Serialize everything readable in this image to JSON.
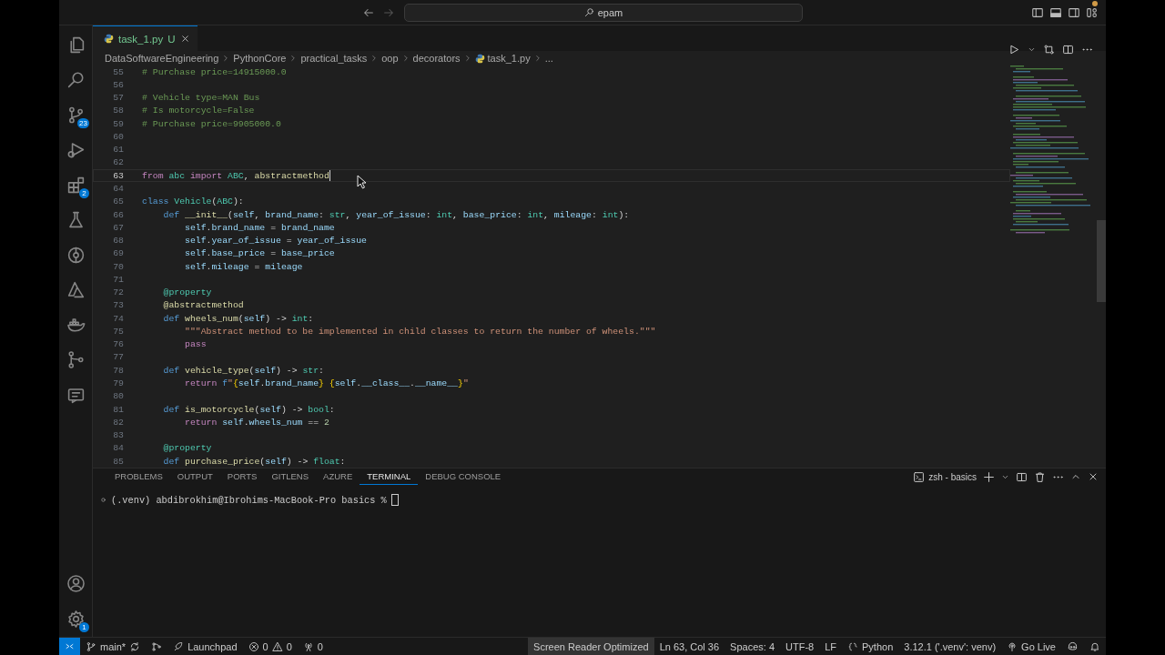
{
  "title_bar": {
    "search": "epam"
  },
  "activity_bar": {
    "top": [
      {
        "kind": "files"
      },
      {
        "kind": "search"
      },
      {
        "kind": "source-control",
        "badge": "23"
      },
      {
        "kind": "run-debug"
      },
      {
        "kind": "extensions",
        "badge": "2"
      },
      {
        "kind": "testing"
      },
      {
        "kind": "gitlens"
      },
      {
        "kind": "azure"
      },
      {
        "kind": "docker"
      },
      {
        "kind": "git-graph"
      },
      {
        "kind": "remote"
      }
    ],
    "bottom": [
      {
        "kind": "account"
      },
      {
        "kind": "settings",
        "badge": "1"
      }
    ]
  },
  "tabs": [
    {
      "label": "task_1.py",
      "status": "U",
      "selected": true
    }
  ],
  "breadcrumb": [
    {
      "text": "DataSoftwareEngineering",
      "kind": "folder"
    },
    {
      "text": "PythonCore",
      "kind": "folder"
    },
    {
      "text": "practical_tasks",
      "kind": "folder"
    },
    {
      "text": "oop",
      "kind": "folder"
    },
    {
      "text": "decorators",
      "kind": "folder"
    },
    {
      "text": "task_1.py",
      "kind": "file"
    },
    {
      "text": "...",
      "kind": "more"
    }
  ],
  "editor": {
    "lines": [
      {
        "number": "55",
        "active": false,
        "tokens": [
          {
            "text": "# Purchase price=14915000.0",
            "kind": "comment"
          }
        ]
      },
      {
        "number": "56",
        "active": false
      },
      {
        "number": "57",
        "active": false,
        "tokens": [
          {
            "text": "# Vehicle type=MAN Bus",
            "kind": "comment"
          }
        ]
      },
      {
        "number": "58",
        "active": false,
        "tokens": [
          {
            "text": "# Is motorcycle=False",
            "kind": "comment"
          }
        ]
      },
      {
        "number": "59",
        "active": false,
        "tokens": [
          {
            "text": "# Purchase price=9905000.0",
            "kind": "comment"
          }
        ]
      },
      {
        "number": "60",
        "active": false
      },
      {
        "number": "61",
        "active": false
      },
      {
        "number": "62",
        "active": false
      },
      {
        "number": "63",
        "active": true,
        "tokens": [
          {
            "text": "from ",
            "kind": "control"
          },
          {
            "text": "abc ",
            "kind": "class"
          },
          {
            "text": "import ",
            "kind": "control"
          },
          {
            "text": "ABC",
            "kind": "class"
          },
          {
            "text": ", ",
            "kind": "plain"
          },
          {
            "text": "abstractmethod",
            "kind": "function"
          }
        ]
      },
      {
        "number": "64",
        "active": false
      },
      {
        "number": "65",
        "active": false,
        "tokens": [
          {
            "text": "class ",
            "kind": "keyword"
          },
          {
            "text": "Vehicle",
            "kind": "class"
          },
          {
            "text": "(",
            "kind": "plain"
          },
          {
            "text": "ABC",
            "kind": "class"
          },
          {
            "text": "):",
            "kind": "plain"
          }
        ]
      },
      {
        "number": "66",
        "active": false,
        "tokens": [
          {
            "text": "    def ",
            "kind": "keyword"
          },
          {
            "text": "__init__",
            "kind": "function"
          },
          {
            "text": "(",
            "kind": "plain"
          },
          {
            "text": "self",
            "kind": "variable"
          },
          {
            "text": ", ",
            "kind": "plain"
          },
          {
            "text": "brand_name",
            "kind": "variable"
          },
          {
            "text": ": ",
            "kind": "plain"
          },
          {
            "text": "str",
            "kind": "class"
          },
          {
            "text": ", ",
            "kind": "plain"
          },
          {
            "text": "year_of_issue",
            "kind": "variable"
          },
          {
            "text": ": ",
            "kind": "plain"
          },
          {
            "text": "int",
            "kind": "class"
          },
          {
            "text": ", ",
            "kind": "plain"
          },
          {
            "text": "base_price",
            "kind": "variable"
          },
          {
            "text": ": ",
            "kind": "plain"
          },
          {
            "text": "int",
            "kind": "class"
          },
          {
            "text": ", ",
            "kind": "plain"
          },
          {
            "text": "mileage",
            "kind": "variable"
          },
          {
            "text": ": ",
            "kind": "plain"
          },
          {
            "text": "int",
            "kind": "class"
          },
          {
            "text": "):",
            "kind": "plain"
          }
        ]
      },
      {
        "number": "67",
        "active": false,
        "tokens": [
          {
            "text": "        self",
            "kind": "variable"
          },
          {
            "text": ".",
            "kind": "plain"
          },
          {
            "text": "brand_name",
            "kind": "variable"
          },
          {
            "text": " = ",
            "kind": "plain"
          },
          {
            "text": "brand_name",
            "kind": "variable"
          }
        ]
      },
      {
        "number": "68",
        "active": false,
        "tokens": [
          {
            "text": "        self",
            "kind": "variable"
          },
          {
            "text": ".",
            "kind": "plain"
          },
          {
            "text": "year_of_issue",
            "kind": "variable"
          },
          {
            "text": " = ",
            "kind": "plain"
          },
          {
            "text": "year_of_issue",
            "kind": "variable"
          }
        ]
      },
      {
        "number": "69",
        "active": false,
        "tokens": [
          {
            "text": "        self",
            "kind": "variable"
          },
          {
            "text": ".",
            "kind": "plain"
          },
          {
            "text": "base_price",
            "kind": "variable"
          },
          {
            "text": " = ",
            "kind": "plain"
          },
          {
            "text": "base_price",
            "kind": "variable"
          }
        ]
      },
      {
        "number": "70",
        "active": false,
        "tokens": [
          {
            "text": "        self",
            "kind": "variable"
          },
          {
            "text": ".",
            "kind": "plain"
          },
          {
            "text": "mileage",
            "kind": "variable"
          },
          {
            "text": " = ",
            "kind": "plain"
          },
          {
            "text": "mileage",
            "kind": "variable"
          }
        ]
      },
      {
        "number": "71",
        "active": false
      },
      {
        "number": "72",
        "active": false,
        "tokens": [
          {
            "text": "    @property",
            "kind": "decorator"
          }
        ]
      },
      {
        "number": "73",
        "active": false,
        "tokens": [
          {
            "text": "    @abstractmethod",
            "kind": "function"
          }
        ]
      },
      {
        "number": "74",
        "active": false,
        "tokens": [
          {
            "text": "    def ",
            "kind": "keyword"
          },
          {
            "text": "wheels_num",
            "kind": "function"
          },
          {
            "text": "(",
            "kind": "plain"
          },
          {
            "text": "self",
            "kind": "variable"
          },
          {
            "text": ") -> ",
            "kind": "plain"
          },
          {
            "text": "int",
            "kind": "class"
          },
          {
            "text": ":",
            "kind": "plain"
          }
        ]
      },
      {
        "number": "75",
        "active": false,
        "tokens": [
          {
            "text": "        \"\"\"Abstract method to be implemented in child classes to return the number of wheels.\"\"\"",
            "kind": "string"
          }
        ]
      },
      {
        "number": "76",
        "active": false,
        "tokens": [
          {
            "text": "        pass",
            "kind": "control"
          }
        ]
      },
      {
        "number": "77",
        "active": false
      },
      {
        "number": "78",
        "active": false,
        "tokens": [
          {
            "text": "    def ",
            "kind": "keyword"
          },
          {
            "text": "vehicle_type",
            "kind": "function"
          },
          {
            "text": "(",
            "kind": "plain"
          },
          {
            "text": "self",
            "kind": "variable"
          },
          {
            "text": ") -> ",
            "kind": "plain"
          },
          {
            "text": "str",
            "kind": "class"
          },
          {
            "text": ":",
            "kind": "plain"
          }
        ]
      },
      {
        "number": "79",
        "active": false,
        "tokens": [
          {
            "text": "        return ",
            "kind": "control"
          },
          {
            "text": "f",
            "kind": "keyword"
          },
          {
            "text": "\"",
            "kind": "string"
          },
          {
            "text": "{",
            "kind": "brace"
          },
          {
            "text": "self",
            "kind": "variable"
          },
          {
            "text": ".",
            "kind": "plain"
          },
          {
            "text": "brand_name",
            "kind": "variable"
          },
          {
            "text": "} {",
            "kind": "brace"
          },
          {
            "text": "self",
            "kind": "variable"
          },
          {
            "text": ".",
            "kind": "plain"
          },
          {
            "text": "__class__",
            "kind": "variable"
          },
          {
            "text": ".",
            "kind": "plain"
          },
          {
            "text": "__name__",
            "kind": "variable"
          },
          {
            "text": "}",
            "kind": "brace"
          },
          {
            "text": "\"",
            "kind": "string"
          }
        ]
      },
      {
        "number": "80",
        "active": false
      },
      {
        "number": "81",
        "active": false,
        "tokens": [
          {
            "text": "    def ",
            "kind": "keyword"
          },
          {
            "text": "is_motorcycle",
            "kind": "function"
          },
          {
            "text": "(",
            "kind": "plain"
          },
          {
            "text": "self",
            "kind": "variable"
          },
          {
            "text": ") -> ",
            "kind": "plain"
          },
          {
            "text": "bool",
            "kind": "class"
          },
          {
            "text": ":",
            "kind": "plain"
          }
        ]
      },
      {
        "number": "82",
        "active": false,
        "tokens": [
          {
            "text": "        return ",
            "kind": "control"
          },
          {
            "text": "self",
            "kind": "variable"
          },
          {
            "text": ".",
            "kind": "plain"
          },
          {
            "text": "wheels_num",
            "kind": "variable"
          },
          {
            "text": " == ",
            "kind": "plain"
          },
          {
            "text": "2",
            "kind": "number"
          }
        ]
      },
      {
        "number": "83",
        "active": false
      },
      {
        "number": "84",
        "active": false,
        "tokens": [
          {
            "text": "    @property",
            "kind": "decorator"
          }
        ]
      },
      {
        "number": "85",
        "active": false,
        "tokens": [
          {
            "text": "    def ",
            "kind": "keyword"
          },
          {
            "text": "purchase_price",
            "kind": "function"
          },
          {
            "text": "(",
            "kind": "plain"
          },
          {
            "text": "self",
            "kind": "variable"
          },
          {
            "text": ") -> ",
            "kind": "plain"
          },
          {
            "text": "float",
            "kind": "class"
          },
          {
            "text": ":",
            "kind": "plain"
          }
        ]
      }
    ]
  },
  "panel": {
    "tabs": [
      {
        "label": "PROBLEMS",
        "selected": false
      },
      {
        "label": "OUTPUT",
        "selected": false
      },
      {
        "label": "PORTS",
        "selected": false
      },
      {
        "label": "GITLENS",
        "selected": false
      },
      {
        "label": "AZURE",
        "selected": false
      },
      {
        "label": "TERMINAL",
        "selected": true
      },
      {
        "label": "DEBUG CONSOLE",
        "selected": false
      }
    ],
    "terminal_name": "zsh - basics",
    "prompt": "(.venv) abdibrokhim@Ibrohims-MacBook-Pro basics %"
  },
  "status_bar": {
    "branch": "main*",
    "launchpad": "Launchpad",
    "errors": "0",
    "warnings": "0",
    "ports": "0",
    "right": [
      {
        "kind": "highlight",
        "text": "Screen Reader Optimized"
      },
      {
        "kind": "plain",
        "text": "Ln 63, Col 36"
      },
      {
        "kind": "plain",
        "text": "Spaces: 4"
      },
      {
        "kind": "plain",
        "text": "UTF-8"
      },
      {
        "kind": "plain",
        "text": "LF"
      },
      {
        "kind": "language",
        "text": "Python"
      },
      {
        "kind": "plain",
        "text": "3.12.1 ('.venv': venv)"
      },
      {
        "kind": "live",
        "text": "Go Live"
      },
      {
        "kind": "copilot"
      },
      {
        "kind": "bell"
      }
    ]
  }
}
